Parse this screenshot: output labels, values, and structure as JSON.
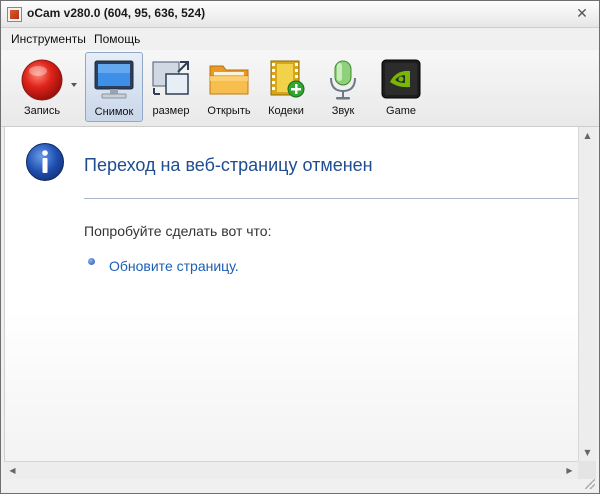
{
  "window": {
    "title": "oCam v280.0 (604, 95, 636, 524)",
    "close_glyph": "✕"
  },
  "menu": {
    "items": [
      {
        "label": "Инструменты"
      },
      {
        "label": "Помощь"
      }
    ]
  },
  "toolbar": {
    "tools": [
      {
        "label": "Запись",
        "icon": "record-icon"
      },
      {
        "label": "Снимок",
        "icon": "monitor-icon",
        "active": true
      },
      {
        "label": "размер",
        "icon": "resize-icon"
      },
      {
        "label": "Открыть",
        "icon": "folder-icon"
      },
      {
        "label": "Кодеки",
        "icon": "codec-film-icon"
      },
      {
        "label": "Звук",
        "icon": "microphone-icon"
      },
      {
        "label": "Game",
        "icon": "nvidia-game-icon"
      }
    ]
  },
  "content": {
    "title": "Переход на веб-страницу отменен",
    "suggest_heading": "Попробуйте сделать вот что:",
    "refresh_link": "Обновите страницу."
  },
  "colors": {
    "title_blue": "#1f4d8f",
    "link_blue": "#1c5fb5",
    "record_red": "#e0251b",
    "folder_orange": "#f2a93b",
    "nvidia_green": "#76b900"
  }
}
